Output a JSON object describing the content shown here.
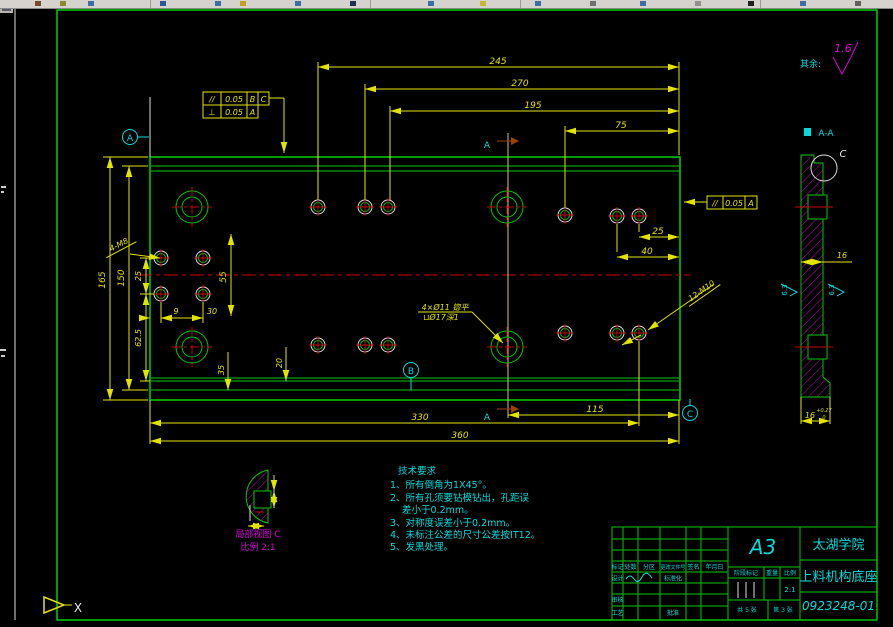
{
  "surface_note": {
    "label": "其余:",
    "value": "1.6"
  },
  "fcf": {
    "f1r1": {
      "sym": "//",
      "tol": "0.05",
      "ref1": "B",
      "ref2": "C"
    },
    "f1r2": {
      "sym": "⊥",
      "tol": "0.05",
      "ref1": "A"
    },
    "f2": {
      "sym": "//",
      "tol": "0.05",
      "ref1": "A"
    }
  },
  "datums": {
    "a": "A",
    "b": "B",
    "c": "C"
  },
  "sections": {
    "cut_label": "A",
    "view_title": "A-A",
    "detail_letter": "C"
  },
  "dims": {
    "top": [
      "245",
      "270",
      "195",
      "75"
    ],
    "right_cluster": [
      "25",
      "40"
    ],
    "left": [
      "165",
      "150",
      "25",
      "62.5"
    ],
    "mid": [
      "55",
      "9",
      "30"
    ],
    "bottom": [
      "330",
      "115",
      "360",
      "35",
      "20"
    ],
    "side_width": "16",
    "side_base": "16",
    "side_base_tol_up": "+0.27",
    "side_base_tol_dn": "0"
  },
  "leaders": {
    "m8": "4-M8",
    "m10": "12-M10",
    "cbore_line1": "4×Ø11 锪平",
    "cbore_line2": "⊔Ø17深1"
  },
  "roughness": {
    "side1": "6.3",
    "side2": "6.3"
  },
  "detail_view": {
    "title": "局部视图 C",
    "scale": "比例 2:1"
  },
  "tech": {
    "title": "技术要求",
    "lines": [
      "1、所有倒角为1X45°。",
      "2、所有孔须要钻模钻出，孔距误",
      "差小于0.2mm。",
      "3、对称度误差小于0.2mm。",
      "4、未标注公差的尺寸公差按IT12。",
      "5、发黑处理。"
    ]
  },
  "titleblock": {
    "paper_size": "A3",
    "school": "太湖学院",
    "part_name": "上料机构底座",
    "drawing_number": "0923248-01",
    "rev_header": [
      "标记",
      "处数",
      "分区",
      "更改文件号",
      "签名",
      "年月日"
    ],
    "roles": {
      "design": "设计",
      "standardize": "标准化",
      "check": "审核",
      "process": "工艺",
      "approve": "批准"
    },
    "stage_label": "阶段标记",
    "weight_label": "重量",
    "scale_label": "比例",
    "scale_value": "2:1",
    "sheet_total": "共 5 张",
    "sheet_current": "第 3 张"
  },
  "ucs": {
    "x_label": "X"
  }
}
